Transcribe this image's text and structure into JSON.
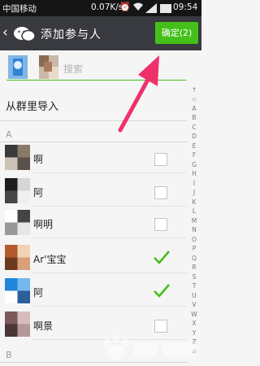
{
  "status_bar": {
    "carrier": "中国移动",
    "speed": "0.07K/s",
    "time": "09:54",
    "icons": [
      "alarm-icon",
      "wifi-icon",
      "signal-icon",
      "battery-icon"
    ]
  },
  "header": {
    "back_icon": "‹",
    "title": "添加参与人",
    "confirm_label": "确定(2)"
  },
  "search": {
    "placeholder": "搜索"
  },
  "group_import_label": "从群里导入",
  "sections": [
    {
      "letter": "A",
      "contacts": [
        {
          "name": "啊",
          "checked": false,
          "avatar_colors": [
            "#3a3a3a",
            "#8a7a6a",
            "#c9c2b5",
            "#5a524a"
          ]
        },
        {
          "name": "阿",
          "checked": false,
          "avatar_colors": [
            "#1d1d1d",
            "#d6d6d6",
            "#464646",
            "#efefef"
          ]
        },
        {
          "name": "啊明",
          "checked": false,
          "avatar_colors": [
            "#ffffff",
            "#444444",
            "#999999",
            "#e6e6e6"
          ]
        },
        {
          "name": "Ar'宝宝",
          "checked": true,
          "avatar_colors": [
            "#b25a2e",
            "#f0d3b4",
            "#6e3a1f",
            "#d9a07a"
          ]
        },
        {
          "name": "阿",
          "checked": true,
          "avatar_colors": [
            "#1f86d9",
            "#75b8ef",
            "#ffffff",
            "#2a5f9a"
          ]
        },
        {
          "name": "啊景",
          "checked": false,
          "avatar_colors": [
            "#7a5a5a",
            "#d6bcbc",
            "#4a3636",
            "#b59797"
          ]
        }
      ]
    },
    {
      "letter": "B",
      "contacts": []
    }
  ],
  "index_letters": [
    "↑",
    "☆",
    "A",
    "B",
    "C",
    "D",
    "E",
    "F",
    "G",
    "H",
    "I",
    "J",
    "K",
    "L",
    "M",
    "N",
    "O",
    "P",
    "Q",
    "R",
    "S",
    "T",
    "U",
    "V",
    "W",
    "X",
    "Y",
    "Z",
    "#"
  ],
  "colors": {
    "status_bar_bg": "#151515",
    "header_bg": "#393a3f",
    "accent_green": "#45c01a",
    "annotation_arrow": "#f0306a"
  },
  "watermark_icon": "baidu-jingyan-watermark"
}
